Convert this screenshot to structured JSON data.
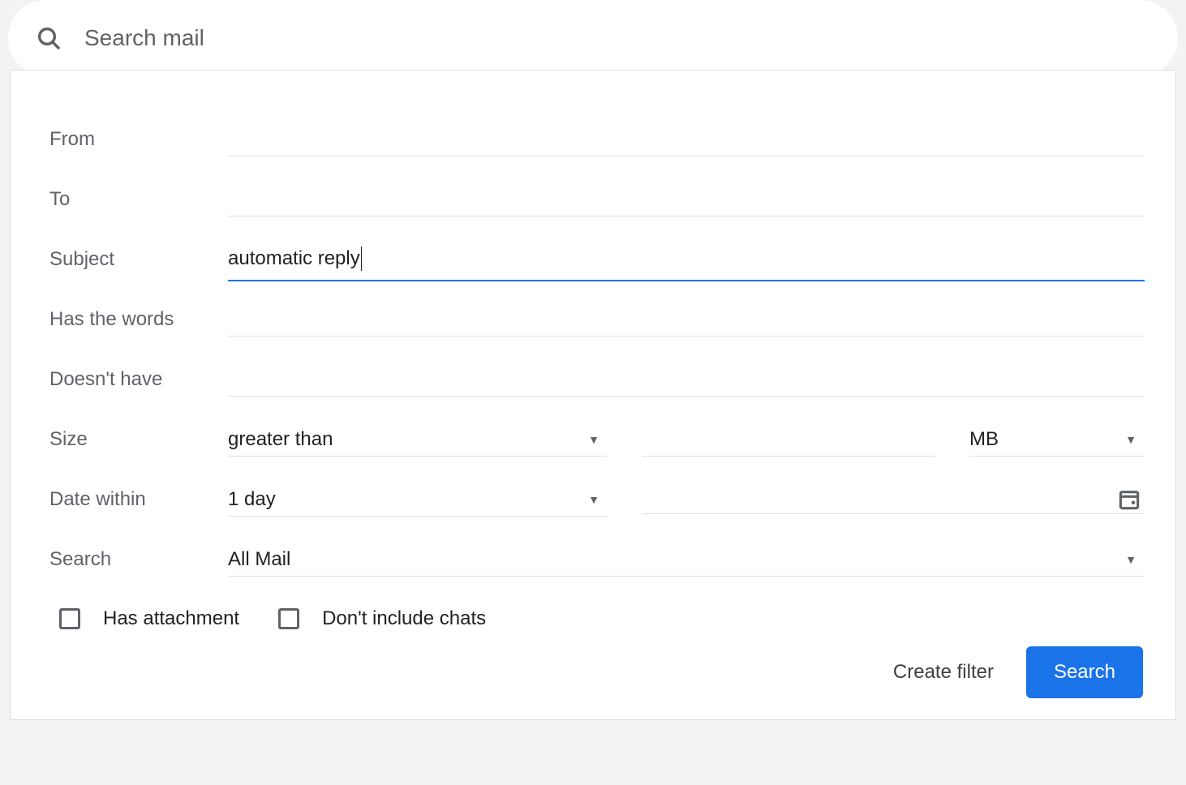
{
  "search_bar": {
    "placeholder": "Search mail"
  },
  "form": {
    "from": {
      "label": "From",
      "value": ""
    },
    "to": {
      "label": "To",
      "value": ""
    },
    "subject": {
      "label": "Subject",
      "value": "automatic reply"
    },
    "has_words": {
      "label": "Has the words",
      "value": ""
    },
    "doesnt_have": {
      "label": "Doesn't have",
      "value": ""
    },
    "size": {
      "label": "Size",
      "operator": "greater than",
      "value": "",
      "unit": "MB"
    },
    "date_within": {
      "label": "Date within",
      "range": "1 day",
      "date_value": ""
    },
    "search_in": {
      "label": "Search",
      "value": "All Mail"
    },
    "has_attachment": {
      "label": "Has attachment",
      "checked": false
    },
    "exclude_chats": {
      "label": "Don't include chats",
      "checked": false
    }
  },
  "actions": {
    "create_filter": "Create filter",
    "search": "Search"
  }
}
